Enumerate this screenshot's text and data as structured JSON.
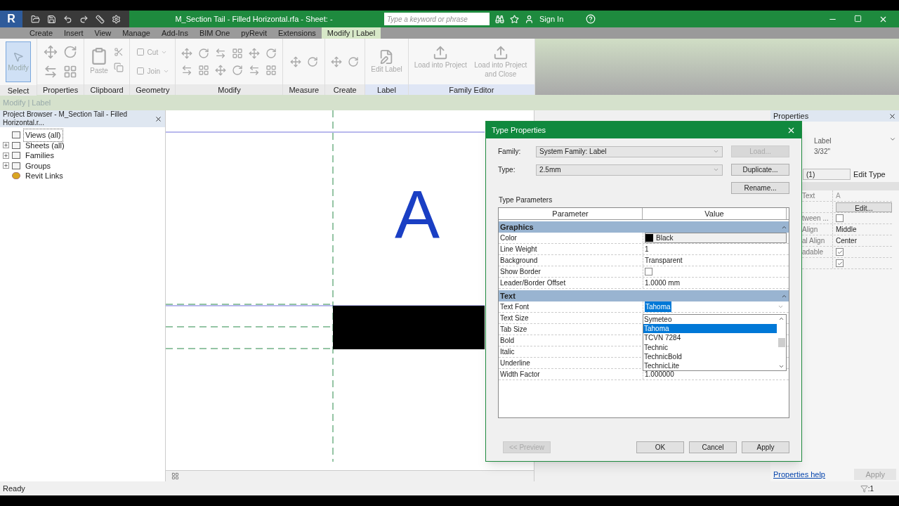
{
  "window": {
    "title": "M_Section Tail - Filled Horizontal.rfa - Sheet: -",
    "search_placeholder": "Type a keyword or phrase",
    "sign_in": "Sign In"
  },
  "app_button": "R",
  "ribbon_tabs": [
    {
      "label": "Create",
      "selected": false
    },
    {
      "label": "Insert",
      "selected": false
    },
    {
      "label": "View",
      "selected": false
    },
    {
      "label": "Manage",
      "selected": false
    },
    {
      "label": "Add-Ins",
      "selected": false
    },
    {
      "label": "BIM One",
      "selected": false
    },
    {
      "label": "pyRevit",
      "selected": false
    },
    {
      "label": "Extensions",
      "selected": false
    },
    {
      "label": "Modify | Label",
      "selected": true
    }
  ],
  "ribbon_panels": [
    {
      "label": "Select",
      "kind": "select",
      "buttons": [
        "Modify"
      ]
    },
    {
      "label": "Properties",
      "kind": "icons"
    },
    {
      "label": "Clipboard",
      "kind": "clipboard",
      "buttons": [
        "Paste"
      ]
    },
    {
      "label": "Geometry",
      "kind": "geometry",
      "buttons": [
        "Cut",
        "Join"
      ]
    },
    {
      "label": "Modify",
      "kind": "icons"
    },
    {
      "label": "Measure",
      "kind": "icons"
    },
    {
      "label": "Create",
      "kind": "icons"
    },
    {
      "label": "Label",
      "kind": "large",
      "buttons": [
        "Edit Label"
      ]
    },
    {
      "label": "Family Editor",
      "kind": "large",
      "buttons": [
        "Load into Project",
        "Load into Project and Close"
      ]
    }
  ],
  "options_bar": "Modify | Label",
  "project_browser": {
    "title": "Project Browser - M_Section Tail - Filled Horizontal.r...",
    "items": [
      {
        "label": "Views (all)",
        "expandable": false,
        "selected": true,
        "kind": "views"
      },
      {
        "label": "Sheets (all)",
        "expandable": true,
        "selected": false,
        "kind": "sheets"
      },
      {
        "label": "Families",
        "expandable": true,
        "selected": false,
        "kind": "families"
      },
      {
        "label": "Groups",
        "expandable": true,
        "selected": false,
        "kind": "groups"
      },
      {
        "label": "Revit Links",
        "expandable": false,
        "selected": false,
        "kind": "links"
      }
    ]
  },
  "canvas": {
    "label_text": "A"
  },
  "properties": {
    "title": "Properties",
    "type_name": "Label",
    "type_size": "3/32\"",
    "selector": "(1)",
    "edit_type": "Edit Type",
    "rows": [
      {
        "kind": "text",
        "label": "Text",
        "value": "A"
      },
      {
        "kind": "button",
        "value": "Edit..."
      },
      {
        "kind": "check",
        "label": "tween ...",
        "checked": false
      },
      {
        "kind": "text",
        "label": "Align",
        "value": "Middle"
      },
      {
        "kind": "text",
        "label": "al Align",
        "value": "Center"
      },
      {
        "kind": "check",
        "label": "adable",
        "checked": true
      },
      {
        "kind": "check",
        "checked": true
      }
    ],
    "help": "Properties help",
    "apply": "Apply"
  },
  "dialog": {
    "title": "Type Properties",
    "family_label": "Family:",
    "family_value": "System Family: Label",
    "type_label": "Type:",
    "type_value": "2.5mm",
    "side_buttons": [
      {
        "label": "Load...",
        "disabled": true
      },
      {
        "label": "Duplicate...",
        "disabled": false
      },
      {
        "label": "Rename...",
        "disabled": false
      }
    ],
    "section_title": "Type Parameters",
    "columns": [
      "Parameter",
      "Value"
    ],
    "groups": [
      {
        "name": "Graphics",
        "rows": [
          {
            "kind": "color",
            "label": "Color",
            "value": "Black",
            "color": "#000000"
          },
          {
            "kind": "text",
            "label": "Line Weight",
            "value": "1"
          },
          {
            "kind": "text",
            "label": "Background",
            "value": "Transparent"
          },
          {
            "kind": "check",
            "label": "Show Border",
            "checked": false
          },
          {
            "kind": "text",
            "label": "Leader/Border Offset",
            "value": "1.0000 mm"
          }
        ]
      },
      {
        "name": "Text",
        "rows": [
          {
            "kind": "combo",
            "label": "Text Font",
            "value": "Tahoma"
          },
          {
            "kind": "hidden",
            "label": "Text Size"
          },
          {
            "kind": "hidden",
            "label": "Tab Size"
          },
          {
            "kind": "hidden",
            "label": "Bold"
          },
          {
            "kind": "hidden",
            "label": "Italic"
          },
          {
            "kind": "hidden",
            "label": "Underline"
          },
          {
            "kind": "text",
            "label": "Width Factor",
            "value": "1.000000"
          }
        ]
      }
    ],
    "font_list": [
      {
        "label": "Symeteo",
        "selected": false
      },
      {
        "label": "Tahoma",
        "selected": true
      },
      {
        "label": "TCVN 7284",
        "selected": false
      },
      {
        "label": "Technic",
        "selected": false
      },
      {
        "label": "TechnicBold",
        "selected": false
      },
      {
        "label": "TechnicLite",
        "selected": false
      }
    ],
    "footer_buttons": [
      {
        "label": "<< Preview",
        "disabled": true
      },
      {
        "label": "OK",
        "disabled": false
      },
      {
        "label": "Cancel",
        "disabled": false
      },
      {
        "label": "Apply",
        "disabled": false
      }
    ]
  },
  "status_bar": {
    "text": "Ready",
    "filter_count": ":1"
  }
}
